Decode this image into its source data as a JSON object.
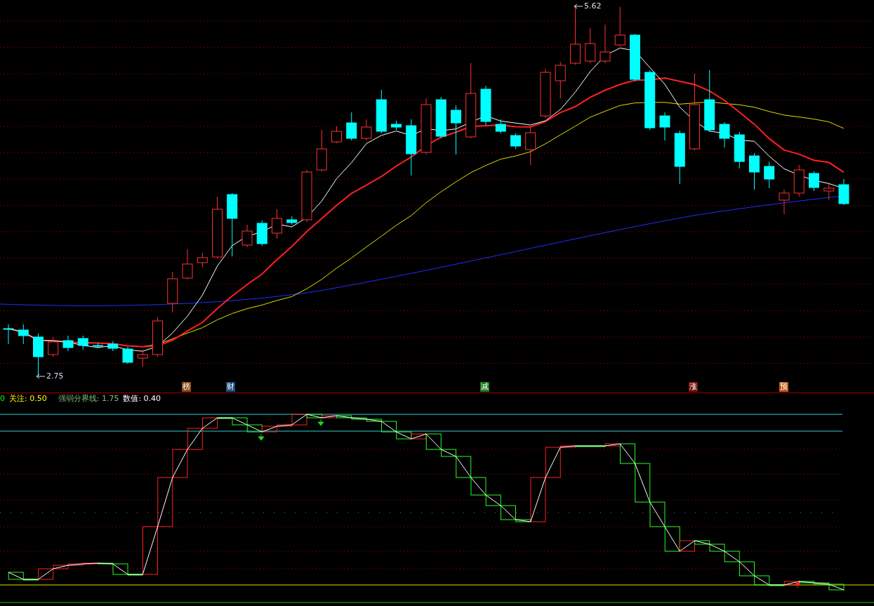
{
  "price_panel": {
    "high_label": "5.62",
    "low_label": "2.75",
    "markers": [
      {
        "label": "榜",
        "color": "#8b4a14"
      },
      {
        "label": "财",
        "color": "#1c4a80"
      },
      {
        "label": "减",
        "color": "#1a7a1a"
      },
      {
        "label": "涨",
        "color": "#7a1010"
      },
      {
        "label": "预",
        "color": "#c0561a"
      }
    ]
  },
  "indicator_panel": {
    "legend": [
      {
        "text": "0",
        "color": "#00ff00"
      },
      {
        "text": "关注: 0.50",
        "color": "#ffff00"
      },
      {
        "text": "强弱分界线: 1.75",
        "color": "#7fbf7f"
      },
      {
        "text": "数值: 0.40",
        "color": "#ffffff"
      }
    ]
  }
}
